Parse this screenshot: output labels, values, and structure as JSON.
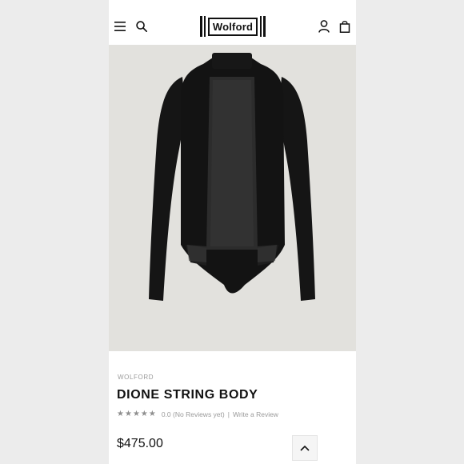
{
  "header": {
    "logo_text": "Wolford",
    "icons": {
      "menu": "menu-icon",
      "search": "search-icon",
      "account": "account-icon",
      "bag": "bag-icon"
    }
  },
  "product": {
    "brand": "WOLFORD",
    "title": "DIONE STRING BODY",
    "rating_text": "0.0 (No Reviews yet)",
    "separator": "|",
    "write_review": "Write a Review",
    "price": "$475.00",
    "star_count": 5
  },
  "colors": {
    "image_background": "#e2e1dd",
    "garment": "#151515",
    "text_primary": "#111111",
    "text_muted": "#9a9a9a"
  }
}
